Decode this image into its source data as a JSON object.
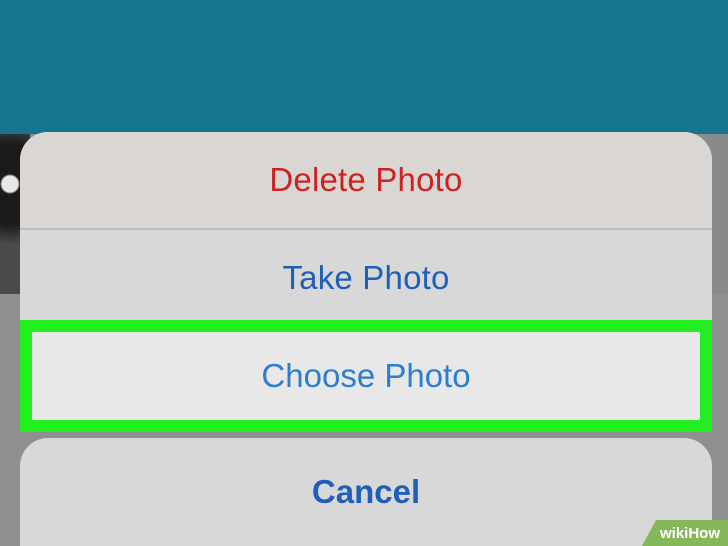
{
  "action_sheet": {
    "items": [
      {
        "label": "Delete Photo",
        "color": "#cc2222"
      },
      {
        "label": "Take Photo",
        "color": "#1f5fb8"
      },
      {
        "label": "Choose Photo",
        "color": "#2a7fd0"
      }
    ],
    "cancel_label": "Cancel",
    "highlight_color": "#22ee22"
  },
  "header": {
    "color": "#15758f"
  },
  "watermark": {
    "text": "wikiHow"
  }
}
